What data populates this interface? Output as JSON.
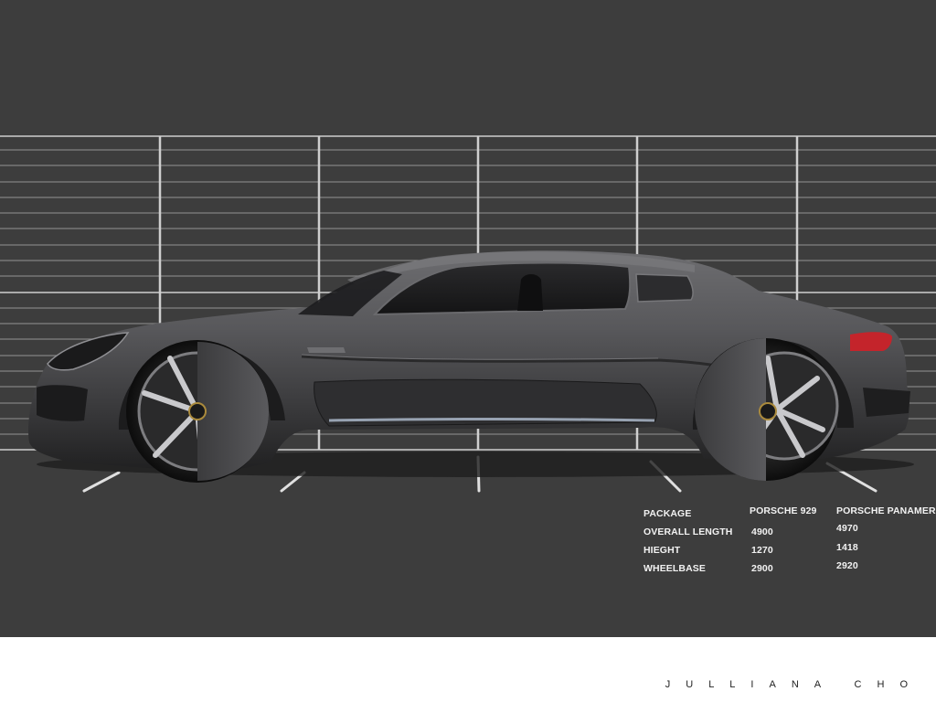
{
  "specs": {
    "header": {
      "label": "PACKAGE",
      "col1": "PORSCHE 929",
      "col2": "PORSCHE PANAMERA"
    },
    "rows": [
      {
        "label": "OVERALL LENGTH",
        "col1": "4900",
        "col2": "4970"
      },
      {
        "label": "HIEGHT",
        "col1": "1270",
        "col2": "1418"
      },
      {
        "label": "WHEELBASE",
        "col1": "2900",
        "col2": "2920"
      }
    ]
  },
  "signature": "JULLIANA CHO",
  "colors": {
    "background": "#3d3d3d",
    "grid": "#bdbdbd",
    "car_body": "#4a4a4c",
    "taillight": "#c4242b",
    "footer": "#ffffff"
  }
}
